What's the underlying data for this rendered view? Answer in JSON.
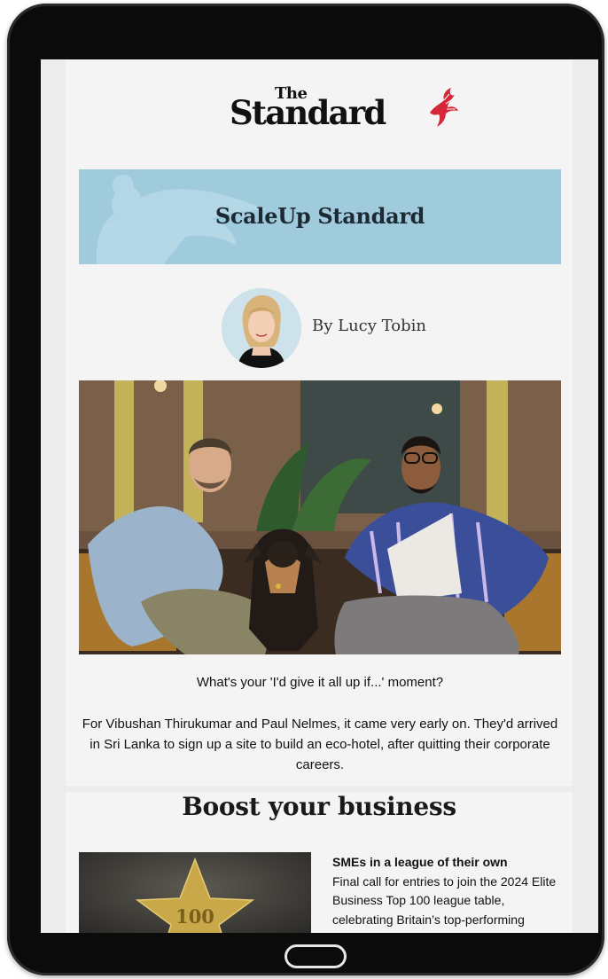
{
  "brand": {
    "the": "The",
    "standard": "Standard"
  },
  "newsletter": {
    "title": "ScaleUp Standard"
  },
  "author": {
    "byline": "By Lucy Tobin"
  },
  "intro": {
    "question": "What's your 'I'd give it all up if...' moment?",
    "paragraph": "For Vibushan Thirukumar and Paul Nelmes, it came very early on. They'd arrived in Sri Lanka to sign up a site to build an eco-hotel, after quitting their corporate careers."
  },
  "section": {
    "title": "Boost your business"
  },
  "article": {
    "title": "SMEs in a league of their own",
    "summary": "Final call for entries to join the 2024 Elite Business Top 100 league table, celebrating Britain’s top-performing",
    "badge_text": "100"
  },
  "colors": {
    "banner": "#9fcbdd",
    "logo_accent": "#d6283b",
    "page": "#f4f4f4"
  },
  "icons": {
    "logo_mark": "red-bird-icon",
    "home": "home-button"
  }
}
